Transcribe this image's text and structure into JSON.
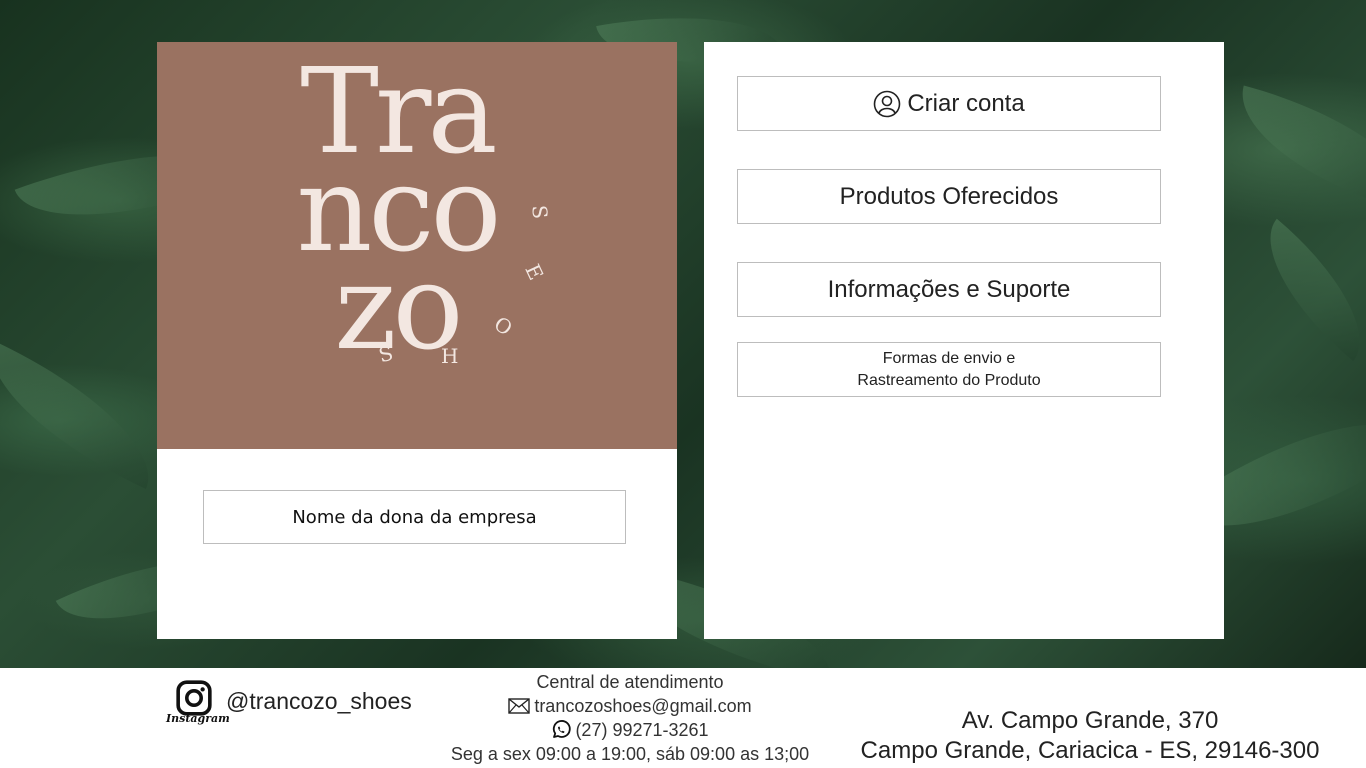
{
  "brand": {
    "logo_line1": "Tra",
    "logo_line2": "nco",
    "logo_line3": "zo",
    "logo_sub_letters": [
      "S",
      "H",
      "O",
      "E",
      "S"
    ],
    "panel_color": "#9a7261"
  },
  "left_card": {
    "owner_label": "Nome da dona da empresa"
  },
  "menu": {
    "create_account": "Criar conta",
    "products": "Produtos Oferecidos",
    "info_support": "Informações e Suporte",
    "shipping_line1": "Formas de envio e",
    "shipping_line2": "Rastreamento do Produto"
  },
  "footer": {
    "instagram_label": "Instagram",
    "instagram_handle": "@trancozo_shoes",
    "contact_title": "Central de atendimento",
    "email": "trancozoshoes@gmail.com",
    "phone": "(27) 99271-3261",
    "hours": "Seg a sex 09:00 a 19:00, sáb 09:00 as 13;00",
    "address_line1": "Av. Campo Grande, 370",
    "address_line2": "Campo Grande, Cariacica - ES, 29146-300"
  },
  "icons": {
    "account": "user-circle-icon",
    "instagram": "instagram-icon",
    "email": "mail-icon",
    "phone": "whatsapp-icon"
  }
}
